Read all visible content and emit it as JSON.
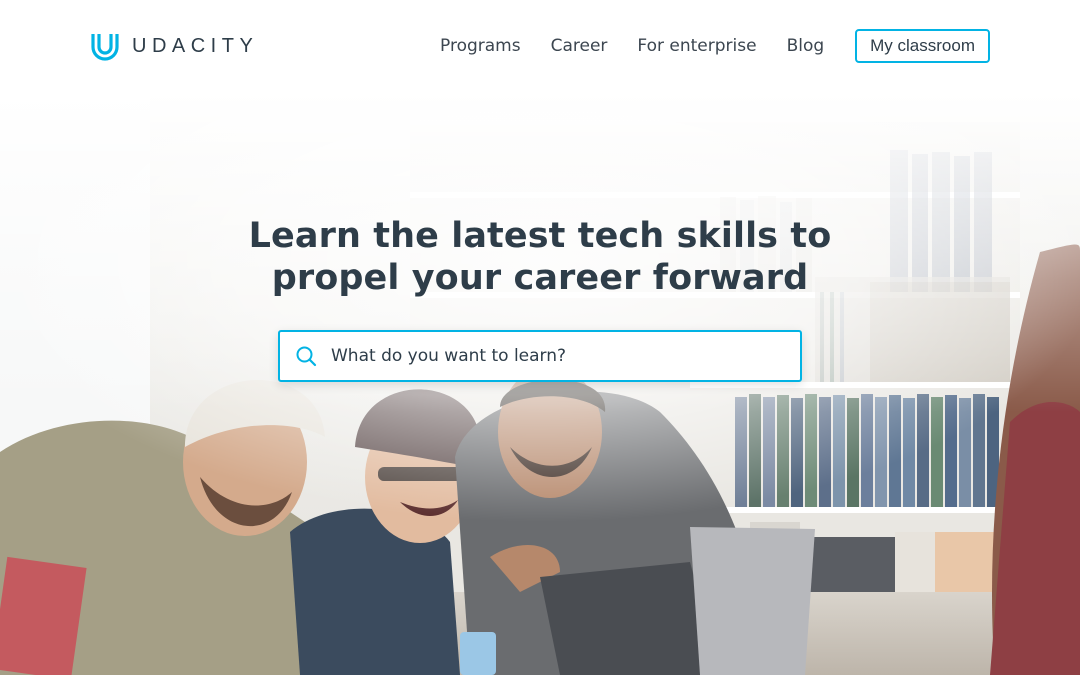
{
  "brand": {
    "name": "UDACITY",
    "accent": "#02b3e4",
    "text_color": "#2e3d49"
  },
  "nav": {
    "links": [
      "Programs",
      "Career",
      "For enterprise",
      "Blog"
    ],
    "classroom_button": "My classroom"
  },
  "hero": {
    "title_line1": "Learn the latest tech skills to",
    "title_line2": "propel your career forward",
    "photo_icon": "students-laughing-at-laptops-photo"
  },
  "search": {
    "placeholder": "What do you want to learn?",
    "value": "",
    "icon": "search-icon"
  }
}
